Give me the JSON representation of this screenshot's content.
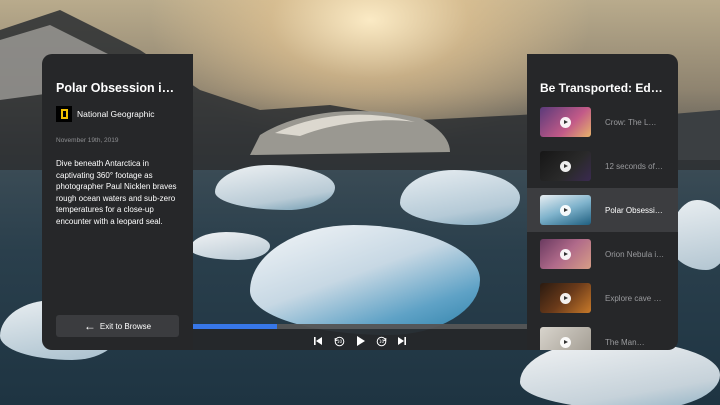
{
  "video": {
    "title": "Polar Obsession in…",
    "channel": "National Geographic",
    "date": "November 19th, 2019",
    "description": "Dive beneath Antarctica in captivating 360° footage as photographer Paul Nicklen braves rough ocean waters and sub-zero temperatures for a close-up encounter with a leopard seal.",
    "exit_label": "Exit to Browse",
    "progress": 0.25
  },
  "playlist": {
    "title": "Be Transported: Edito…",
    "items": [
      {
        "label": "Crow: The L…"
      },
      {
        "label": "12 seconds of…"
      },
      {
        "label": "Polar Obsessi…",
        "active": true
      },
      {
        "label": "Orion Nebula i…"
      },
      {
        "label": "Explore cave p…"
      },
      {
        "label": "The Man…"
      }
    ]
  },
  "controls": {
    "icons": [
      "skip-previous-icon",
      "rewind-10-icon",
      "play-icon",
      "forward-10-icon",
      "skip-next-icon"
    ]
  },
  "colors": {
    "panel": "#262729",
    "accent": "#3777e8",
    "active_row": "#3c3d40"
  }
}
